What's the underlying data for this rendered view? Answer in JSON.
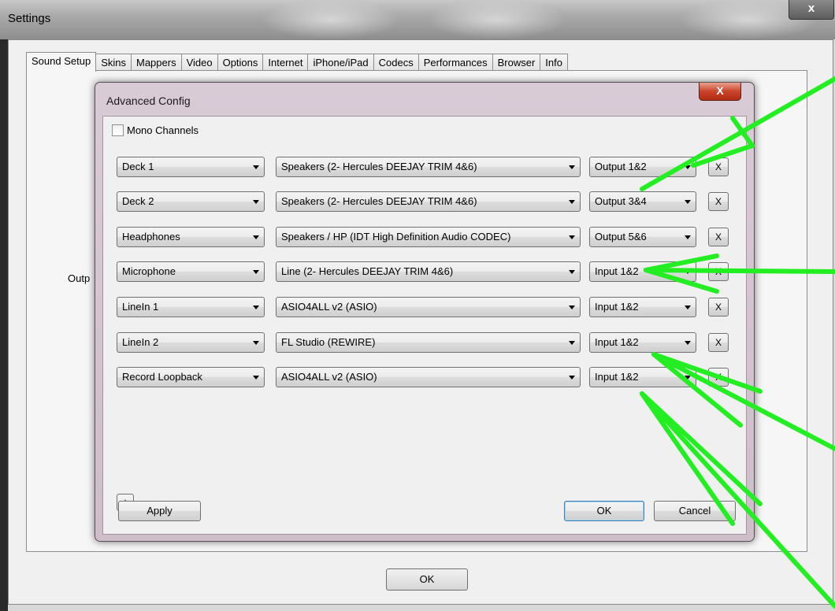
{
  "settings": {
    "title": "Settings",
    "close_label": "x",
    "tabs": [
      "Sound Setup",
      "Skins",
      "Mappers",
      "Video",
      "Options",
      "Internet",
      "iPhone/iPad",
      "Codecs",
      "Performances",
      "Browser",
      "Info"
    ],
    "active_tab": "Sound Setup",
    "partial_label": "Outp",
    "ok_label": "OK"
  },
  "dialog": {
    "title": "Advanced Config",
    "close_label": "X",
    "mono_label": "Mono Channels",
    "mono_checked": false,
    "rows": [
      {
        "channel": "Deck 1",
        "device": "Speakers (2- Hercules DEEJAY TRIM 4&6)",
        "port": "Output 1&2",
        "remove": "X"
      },
      {
        "channel": "Deck 2",
        "device": "Speakers (2- Hercules DEEJAY TRIM 4&6)",
        "port": "Output 3&4",
        "remove": "X"
      },
      {
        "channel": "Headphones",
        "device": "Speakers / HP (IDT High Definition Audio CODEC)",
        "port": "Output 5&6",
        "remove": "X"
      },
      {
        "channel": "Microphone",
        "device": "Line (2- Hercules DEEJAY TRIM 4&6)",
        "port": "Input 1&2",
        "remove": "X"
      },
      {
        "channel": "LineIn 1",
        "device": "ASIO4ALL v2 (ASIO)",
        "port": "Input 1&2",
        "remove": "X"
      },
      {
        "channel": "LineIn 2",
        "device": "FL Studio (REWIRE)",
        "port": "Input 1&2",
        "remove": "X"
      },
      {
        "channel": "Record Loopback",
        "device": "ASIO4ALL v2 (ASIO)",
        "port": "Input 1&2",
        "remove": "X"
      }
    ],
    "add_label": "+",
    "apply_label": "Apply",
    "ok_label": "OK",
    "cancel_label": "Cancel"
  },
  "colors": {
    "annotation_arrow": "#22ee22",
    "dialog_frame": "#d9cbd6",
    "close_red": "#c9452b"
  }
}
